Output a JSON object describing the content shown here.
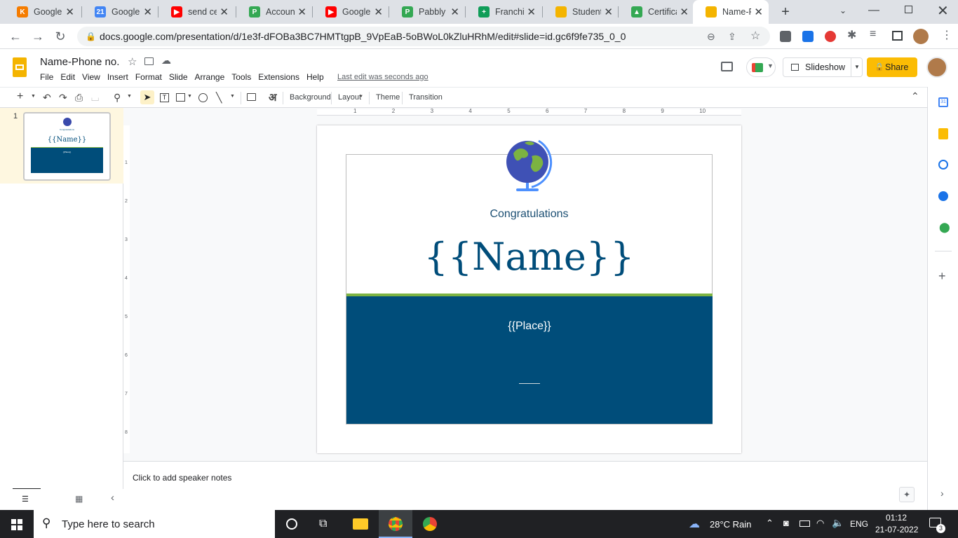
{
  "tabs": [
    {
      "title": "Google",
      "color": "#f57c00",
      "glyph": "K"
    },
    {
      "title": "Google",
      "color": "#4285f4",
      "glyph": "21"
    },
    {
      "title": "send ce",
      "color": "#ff0000",
      "glyph": "▶"
    },
    {
      "title": "Account",
      "color": "#34a853",
      "glyph": "P"
    },
    {
      "title": "Google",
      "color": "#ff0000",
      "glyph": "▶"
    },
    {
      "title": "Pabbly C",
      "color": "#34a853",
      "glyph": "P"
    },
    {
      "title": "Franchis",
      "color": "#0f9d58",
      "glyph": "+"
    },
    {
      "title": "Student",
      "color": "#f4b400",
      "glyph": ""
    },
    {
      "title": "Certifica",
      "color": "#34a853",
      "glyph": "▲"
    },
    {
      "title": "Name-P",
      "color": "#f4b400",
      "glyph": ""
    }
  ],
  "url": "docs.google.com/presentation/d/1e3f-dFOBa3BC7HMTtgpB_9VpEaB-5oBWoL0kZluHRhM/edit#slide=id.gc6f9fe735_0_0",
  "doc": {
    "title": "Name-Phone no.",
    "menu": [
      "File",
      "Edit",
      "View",
      "Insert",
      "Format",
      "Slide",
      "Arrange",
      "Tools",
      "Extensions",
      "Help"
    ],
    "last_edit": "Last edit was seconds ago",
    "slideshow": "Slideshow",
    "share": "Share"
  },
  "toolbar": {
    "background": "Background",
    "layout": "Layout",
    "theme": "Theme",
    "transition": "Transition"
  },
  "ruler": [
    "1",
    "2",
    "3",
    "4",
    "5",
    "6",
    "7",
    "8",
    "9",
    "10"
  ],
  "vruler": [
    "1",
    "2",
    "3",
    "4",
    "5",
    "6",
    "7",
    "8"
  ],
  "slide": {
    "num": "1",
    "congrats": "Congratulations",
    "name": "{{Name}}",
    "place": "{{Place}}",
    "accent": "#004d7a",
    "green": "#7cb342"
  },
  "notes": "Click to add speaker notes",
  "taskbar": {
    "search": "Type here to search",
    "weather": "28°C  Rain",
    "lang": "ENG",
    "time": "01:12",
    "date": "21-07-2022",
    "notif": "3"
  }
}
